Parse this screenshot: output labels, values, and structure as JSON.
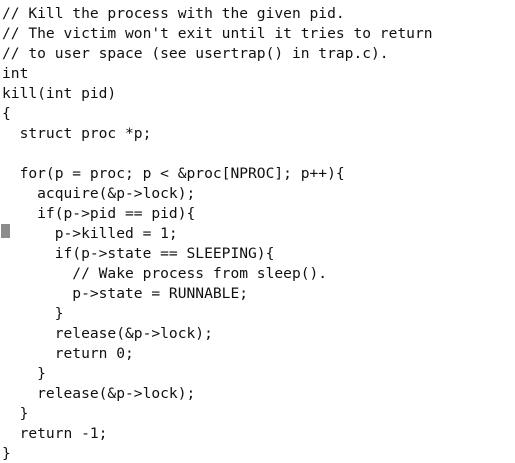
{
  "editor": {
    "lines": [
      "// Kill the process with the given pid.",
      "// The victim won't exit until it tries to return",
      "// to user space (see usertrap() in trap.c).",
      "int",
      "kill(int pid)",
      "{",
      "  struct proc *p;",
      "",
      "  for(p = proc; p < &proc[NPROC]; p++){",
      "    acquire(&p->lock);",
      "    if(p->pid == pid){",
      "      p->killed = 1;",
      "      if(p->state == SLEEPING){",
      "        // Wake process from sleep().",
      "        p->state = RUNNABLE;",
      "      }",
      "      release(&p->lock);",
      "      return 0;",
      "    }",
      "    release(&p->lock);",
      "  }",
      "  return -1;",
      "}"
    ],
    "cursor_color": "#8c8c8c",
    "text_color": "#111111",
    "background_color": "#ffffff"
  }
}
